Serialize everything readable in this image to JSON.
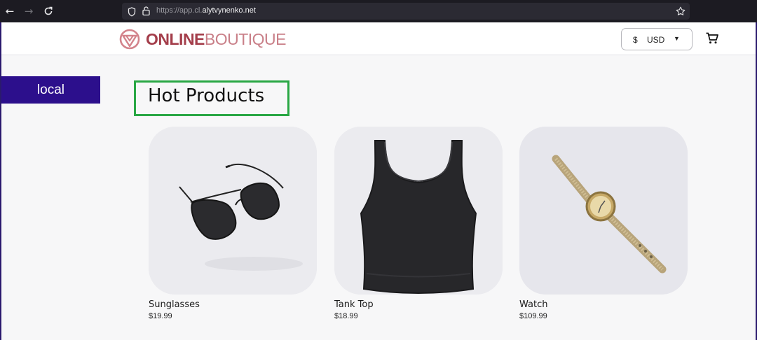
{
  "browser": {
    "url_prefix": "https://app.cl.",
    "url_domain": "alytvynenko.net",
    "icons": [
      "back-icon",
      "forward-icon",
      "reload-icon",
      "shield-icon",
      "lock-icon",
      "star-icon"
    ]
  },
  "header": {
    "logo": {
      "bold": "ONLINE",
      "thin": "BOUTIQUE",
      "color": "#b8555f"
    },
    "currency": {
      "symbol": "$",
      "code": "USD"
    },
    "cart_icon": "cart-icon"
  },
  "env_badge": {
    "label": "local",
    "color": "#2c0f8c"
  },
  "section": {
    "title": "Hot Products",
    "highlight_color": "#29a744"
  },
  "products": [
    {
      "name": "Sunglasses",
      "price": "$19.99",
      "image": "sunglasses-image"
    },
    {
      "name": "Tank Top",
      "price": "$18.99",
      "image": "tank-top-image"
    },
    {
      "name": "Watch",
      "price": "$109.99",
      "image": "watch-image"
    }
  ]
}
